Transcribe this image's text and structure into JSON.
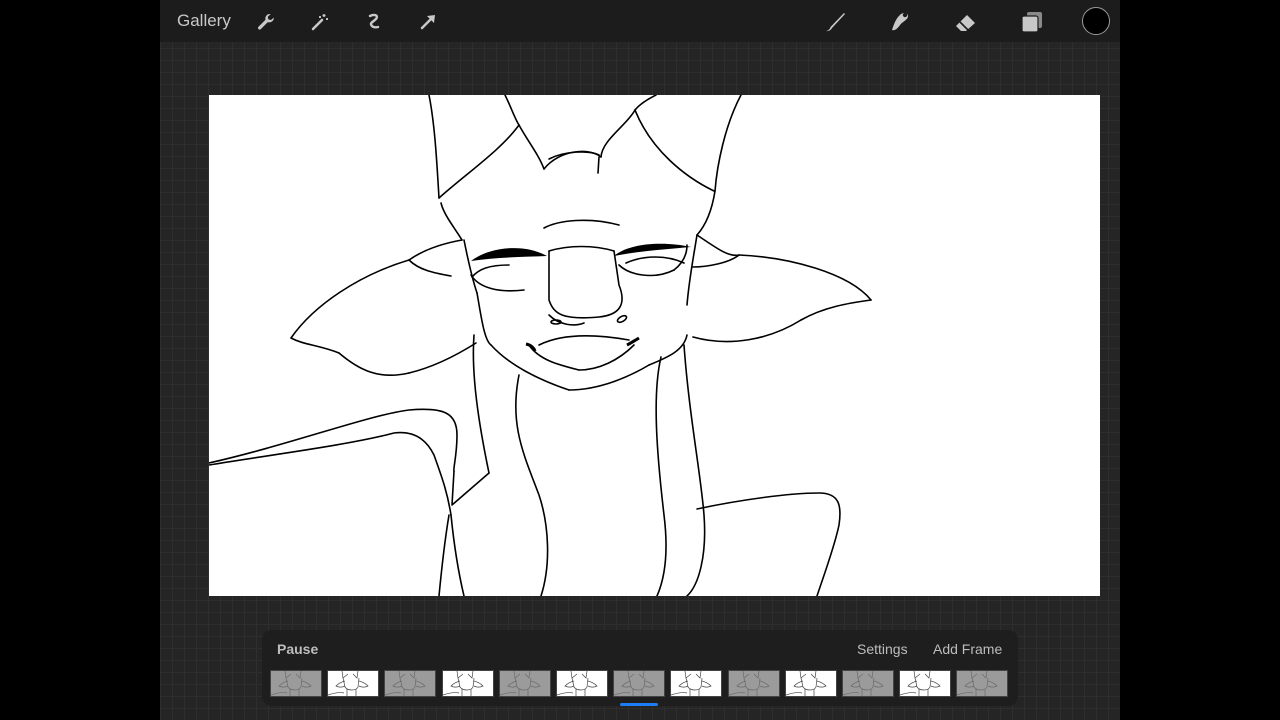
{
  "topbar": {
    "gallery_label": "Gallery",
    "left_tools": [
      "wrench-icon",
      "magic-wand-icon",
      "selection-icon",
      "transform-arrow-icon"
    ],
    "right_tools": [
      "brush-icon",
      "smudge-icon",
      "eraser-icon",
      "layers-icon"
    ],
    "current_color": "#000000"
  },
  "animation": {
    "pause_label": "Pause",
    "settings_label": "Settings",
    "add_frame_label": "Add Frame",
    "frame_count": 13,
    "selected_frame_index": 6,
    "accent": "#1e7cf5"
  }
}
